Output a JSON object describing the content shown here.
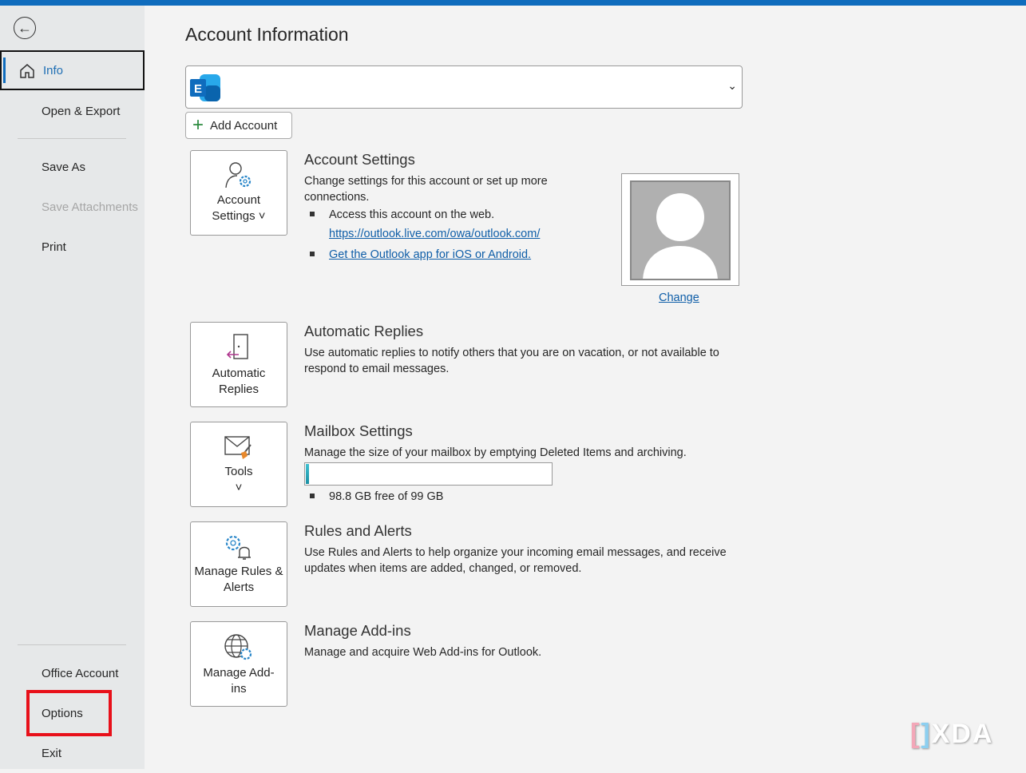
{
  "sidebar": {
    "items": [
      {
        "label": "Info"
      },
      {
        "label": "Open & Export"
      },
      {
        "label": "Save As"
      },
      {
        "label": "Save Attachments"
      },
      {
        "label": "Print"
      },
      {
        "label": "Office Account"
      },
      {
        "label": "Options"
      },
      {
        "label": "Exit"
      }
    ]
  },
  "header": {
    "title": "Account Information"
  },
  "account": {
    "add_label": "Add Account"
  },
  "tiles": [
    {
      "label": "Account Settings ˅"
    },
    {
      "label": "Automatic Replies"
    },
    {
      "label": "Tools ˅"
    },
    {
      "label": "Manage Rules & Alerts"
    },
    {
      "label": "Manage Add-ins"
    }
  ],
  "sections": {
    "account_settings": {
      "title": "Account Settings",
      "desc": "Change settings for this account or set up more connections.",
      "bullet1": "Access this account on the web.",
      "link1": "https://outlook.live.com/owa/outlook.com/",
      "link2": "Get the Outlook app for iOS or Android."
    },
    "auto_replies": {
      "title": "Automatic Replies",
      "desc": "Use automatic replies to notify others that you are on vacation, or not available to respond to email messages."
    },
    "mailbox": {
      "title": "Mailbox Settings",
      "desc": "Manage the size of your mailbox by emptying Deleted Items and archiving.",
      "usage": "98.8 GB free of 99 GB",
      "used_fraction": 0.012
    },
    "rules": {
      "title": "Rules and Alerts",
      "desc": "Use Rules and Alerts to help organize your incoming email messages, and receive updates when items are added, changed, or removed."
    },
    "addins": {
      "title": "Manage Add-ins",
      "desc": "Manage and acquire Web Add-ins for Outlook."
    }
  },
  "photo": {
    "change_label": "Change"
  },
  "watermark": "XDA",
  "colors": {
    "accent": "#0f6cbd",
    "highlight": "#e8101a"
  }
}
